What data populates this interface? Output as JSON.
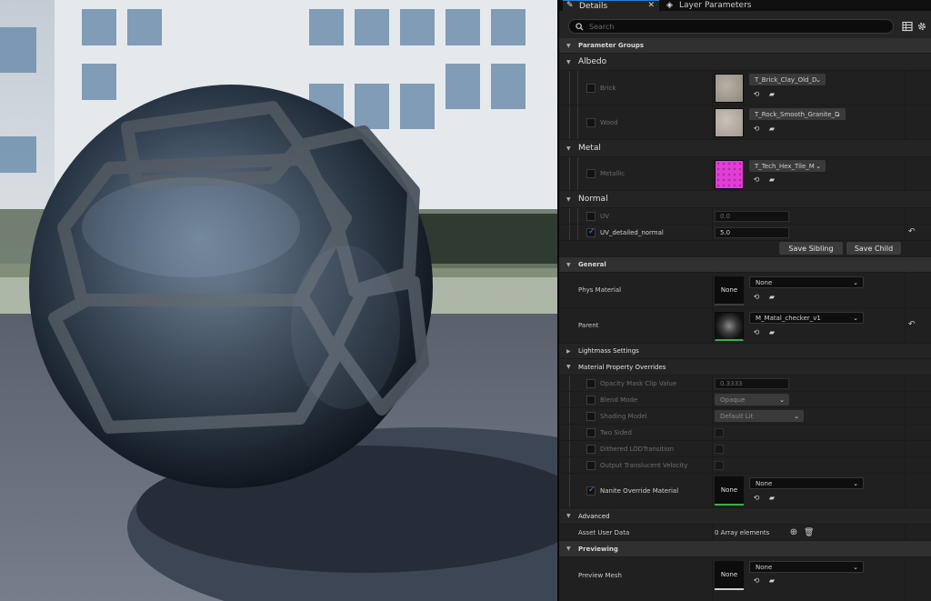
{
  "tabs": {
    "details": "Details",
    "layer_parameters": "Layer Parameters"
  },
  "search": {
    "placeholder": "Search"
  },
  "sections": {
    "parameter_groups": "Parameter Groups",
    "albedo": "Albedo",
    "metal": "Metal",
    "normal": "Normal",
    "general": "General",
    "lightmass": "Lightmass Settings",
    "material_property_overrides": "Material Property Overrides",
    "advanced": "Advanced",
    "previewing": "Previewing"
  },
  "albedo": {
    "brick": {
      "label": "Brick",
      "texture": "T_Brick_Clay_Old_D"
    },
    "wood": {
      "label": "Wood",
      "texture": "T_Rock_Smooth_Granite_D"
    }
  },
  "metal": {
    "metallic": {
      "label": "Metallic",
      "texture": "T_Tech_Hex_Tile_M"
    }
  },
  "normal": {
    "uv": {
      "label": "UV",
      "value": "0.0"
    },
    "uv_detailed": {
      "label": "UV_detailed_normal",
      "value": "5.0"
    },
    "save_sibling": "Save Sibling",
    "save_child": "Save Child"
  },
  "general": {
    "phys_material": {
      "label": "Phys Material",
      "thumb": "None",
      "value": "None"
    },
    "parent": {
      "label": "Parent",
      "value": "M_Matal_checker_v1"
    }
  },
  "overrides": {
    "opacity_mask": {
      "label": "Opacity Mask Clip Value",
      "value": "0.3333"
    },
    "blend_mode": {
      "label": "Blend Mode",
      "value": "Opaque"
    },
    "shading_model": {
      "label": "Shading Model",
      "value": "Default Lit"
    },
    "two_sided": {
      "label": "Two Sided"
    },
    "dithered": {
      "label": "Dithered LODTransition"
    },
    "output_translucent": {
      "label": "Output Translucent Velocity"
    },
    "nanite": {
      "label": "Nanite Override Material",
      "thumb": "None",
      "value": "None"
    }
  },
  "advanced": {
    "asset_user_data": {
      "label": "Asset User Data",
      "value": "0 Array elements"
    }
  },
  "previewing": {
    "preview_mesh": {
      "label": "Preview Mesh",
      "thumb": "None",
      "value": "None"
    }
  },
  "colors": {
    "accent": "#2b7bd8",
    "checkbox_check": "#3d8fe0",
    "green_underline": "#3cb043",
    "hex_magenta": "#e23fd7"
  }
}
